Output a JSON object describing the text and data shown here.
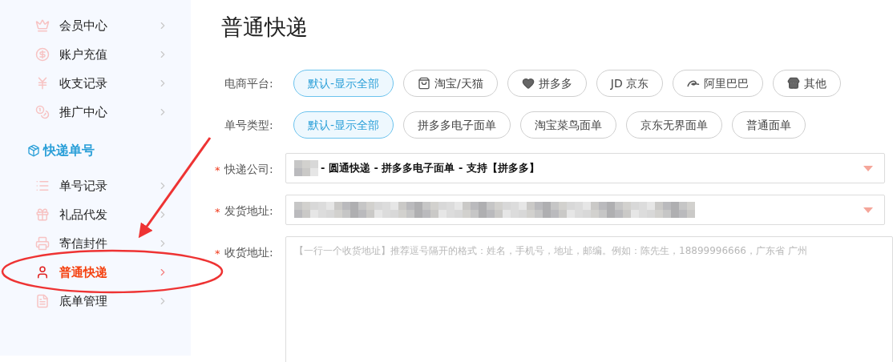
{
  "sidebar": {
    "items": [
      {
        "kind": "item",
        "label": "会员中心",
        "selected": false
      },
      {
        "kind": "item",
        "label": "账户充值",
        "selected": false
      },
      {
        "kind": "item",
        "label": "收支记录",
        "selected": false
      },
      {
        "kind": "item",
        "label": "推广中心",
        "selected": false
      },
      {
        "kind": "section",
        "label": "快递单号",
        "selected": false
      },
      {
        "kind": "item",
        "label": "单号记录",
        "selected": false
      },
      {
        "kind": "item",
        "label": "礼品代发",
        "selected": false
      },
      {
        "kind": "item",
        "label": "寄信封件",
        "selected": false
      },
      {
        "kind": "item",
        "label": "普通快递",
        "selected": true
      },
      {
        "kind": "item",
        "label": "底单管理",
        "selected": false
      }
    ]
  },
  "page_title": "普通快递",
  "filters": [
    {
      "label": "电商平台:",
      "options": [
        {
          "label": "默认-显示全部",
          "selected": true
        },
        {
          "label": "淘宝/天猫",
          "selected": false
        },
        {
          "label": "拼多多",
          "selected": false
        },
        {
          "label": "JD 京东",
          "selected": false
        },
        {
          "label": "阿里巴巴",
          "selected": false
        },
        {
          "label": "其他",
          "selected": false
        }
      ]
    },
    {
      "label": "单号类型:",
      "options": [
        {
          "label": "默认-显示全部",
          "selected": true
        },
        {
          "label": "拼多多电子面单",
          "selected": false
        },
        {
          "label": "淘宝菜鸟面单",
          "selected": false
        },
        {
          "label": "京东无界面单",
          "selected": false
        },
        {
          "label": "普通面单",
          "selected": false
        }
      ]
    }
  ],
  "form": [
    {
      "kind": "select",
      "label": "快递公司:",
      "required_mark": "*",
      "value": "- 圆通快递 - 拼多多电子面单 - 支持【拼多多】"
    },
    {
      "kind": "select",
      "label": "发货地址:",
      "required_mark": "*"
    },
    {
      "kind": "textarea",
      "label": "收货地址:",
      "required_mark": "*",
      "placeholder": "【一行一个收货地址】推荐逗号隔开的格式：姓名，手机号，地址，邮编。例如：陈先生，18899996666，广东省 广州"
    }
  ]
}
